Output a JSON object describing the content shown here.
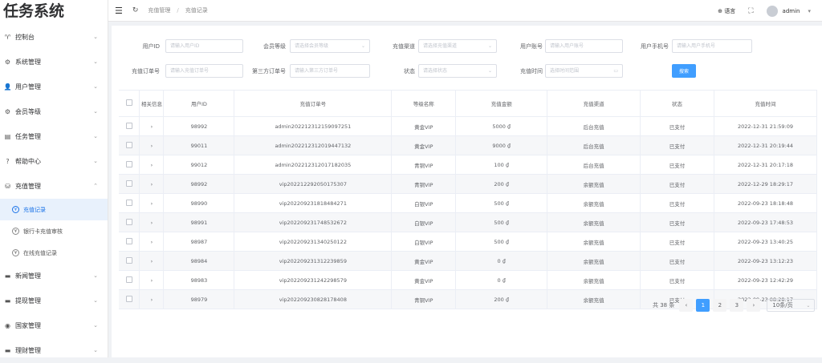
{
  "app": {
    "title": "任务系统"
  },
  "sidebar": {
    "items": [
      {
        "label": "控制台",
        "icon": "dashboard-icon",
        "glyph": "♈"
      },
      {
        "label": "系统管理",
        "icon": "gear-icon",
        "glyph": "⚙"
      },
      {
        "label": "用户管理",
        "icon": "user-icon",
        "glyph": "👤"
      },
      {
        "label": "会员等级",
        "icon": "settings-icon",
        "glyph": "⚙"
      },
      {
        "label": "任务管理",
        "icon": "task-icon",
        "glyph": "▤"
      },
      {
        "label": "帮助中心",
        "icon": "help-icon",
        "glyph": "?"
      },
      {
        "label": "充值管理",
        "icon": "recharge-icon",
        "glyph": "⛁"
      }
    ],
    "subitems": [
      {
        "label": "充值记录",
        "icon": "recharge-record-icon",
        "active": true
      },
      {
        "label": "银行卡充值审核",
        "icon": "bank-card-icon",
        "active": false
      },
      {
        "label": "在线充值记录",
        "icon": "online-recharge-icon",
        "active": false
      }
    ],
    "bottom_items": [
      {
        "label": "新闻管理",
        "icon": "news-icon",
        "glyph": "▬"
      },
      {
        "label": "提现管理",
        "icon": "withdraw-icon",
        "glyph": "▬"
      },
      {
        "label": "国家管理",
        "icon": "country-icon",
        "glyph": "◉"
      },
      {
        "label": "理财管理",
        "icon": "finance-icon",
        "glyph": "▬"
      }
    ]
  },
  "topbar": {
    "breadcrumb": [
      "充值管理",
      "充值记录"
    ],
    "language": "语言",
    "username": "admin"
  },
  "filters": {
    "user_id": {
      "label": "用户ID",
      "placeholder": "请输入用户ID"
    },
    "member_level": {
      "label": "会员等级",
      "placeholder": "请选择会员等级"
    },
    "channel": {
      "label": "充值渠道",
      "placeholder": "请选择充值渠道"
    },
    "account": {
      "label": "用户账号",
      "placeholder": "请输入用户账号"
    },
    "phone": {
      "label": "用户手机号",
      "placeholder": "请输入用户手机号"
    },
    "order_no": {
      "label": "充值订单号",
      "placeholder": "请输入充值订单号"
    },
    "third_order": {
      "label": "第三方订单号",
      "placeholder": "请输入第三方订单号"
    },
    "status": {
      "label": "状态",
      "placeholder": "请选择状态"
    },
    "time": {
      "label": "充值时间",
      "placeholder": "选择时间范围"
    },
    "search_button": "搜索"
  },
  "table": {
    "headers": [
      "相关信息",
      "用户ID",
      "充值订单号",
      "等级名称",
      "充值金额",
      "充值渠道",
      "状态",
      "充值时间"
    ],
    "rows": [
      {
        "id": "98992",
        "order": "admin202212312159097251",
        "level": "黄金VIP",
        "amount": "5000 ₫",
        "channel": "后台充值",
        "status": "已支付",
        "time": "2022-12-31 21:59:09"
      },
      {
        "id": "99011",
        "order": "admin202212312019447132",
        "level": "黄金VIP",
        "amount": "9000 ₫",
        "channel": "后台充值",
        "status": "已支付",
        "time": "2022-12-31 20:19:44"
      },
      {
        "id": "99012",
        "order": "admin202212312017182035",
        "level": "青铜VIP",
        "amount": "100 ₫",
        "channel": "后台充值",
        "status": "已支付",
        "time": "2022-12-31 20:17:18"
      },
      {
        "id": "98992",
        "order": "vip202212292050175307",
        "level": "青铜VIP",
        "amount": "200 ₫",
        "channel": "余额充值",
        "status": "已支付",
        "time": "2022-12-29 18:29:17"
      },
      {
        "id": "98990",
        "order": "vip202209231818484271",
        "level": "白银VIP",
        "amount": "500 ₫",
        "channel": "余额充值",
        "status": "已支付",
        "time": "2022-09-23 18:18:48"
      },
      {
        "id": "98991",
        "order": "vip202209231748532672",
        "level": "白银VIP",
        "amount": "500 ₫",
        "channel": "余额充值",
        "status": "已支付",
        "time": "2022-09-23 17:48:53"
      },
      {
        "id": "98987",
        "order": "vip202209231340250122",
        "level": "白银VIP",
        "amount": "500 ₫",
        "channel": "余额充值",
        "status": "已支付",
        "time": "2022-09-23 13:40:25"
      },
      {
        "id": "98984",
        "order": "vip202209231312239859",
        "level": "黄金VIP",
        "amount": "0 ₫",
        "channel": "余额充值",
        "status": "已支付",
        "time": "2022-09-23 13:12:23"
      },
      {
        "id": "98983",
        "order": "vip202209231242298579",
        "level": "黄金VIP",
        "amount": "0 ₫",
        "channel": "余额充值",
        "status": "已支付",
        "time": "2022-09-23 12:42:29"
      },
      {
        "id": "98979",
        "order": "vip202209230828178408",
        "level": "青铜VIP",
        "amount": "200 ₫",
        "channel": "余额充值",
        "status": "已支付",
        "time": "2022-09-23 08:28:17"
      }
    ]
  },
  "pagination": {
    "total": "共 38 条",
    "pages": [
      "1",
      "2",
      "3"
    ],
    "page_size": "10条/页"
  }
}
